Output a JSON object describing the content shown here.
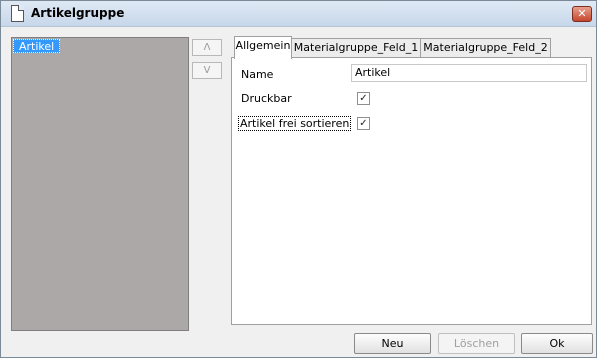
{
  "window": {
    "title": "Artikelgruppe",
    "close_glyph": "✕"
  },
  "list": {
    "items": [
      {
        "label": "Artikel"
      }
    ]
  },
  "move_buttons": {
    "up_glyph": "Λ",
    "down_glyph": "V"
  },
  "tabs": [
    {
      "label": "Allgemein"
    },
    {
      "label": "Materialgruppe_Feld_1"
    },
    {
      "label": "Materialgruppe_Feld_2"
    }
  ],
  "fields": {
    "name_label": "Name",
    "name_value": "Artikel",
    "druckbar_label": "Druckbar",
    "druckbar_checked": "✓",
    "sort_label": "Artikel frei sortieren",
    "sort_checked": "✓"
  },
  "buttons": {
    "new_label": "Neu",
    "delete_label": "Löschen",
    "ok_label": "Ok"
  }
}
